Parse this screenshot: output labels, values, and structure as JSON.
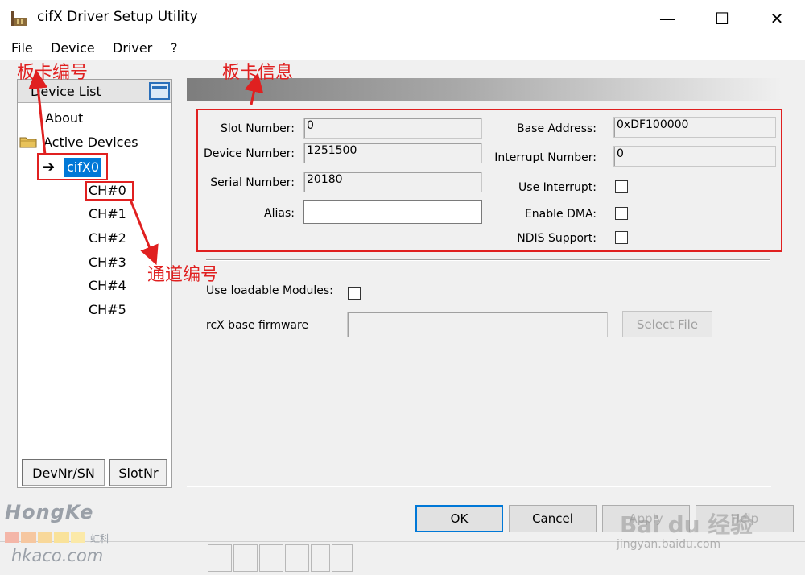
{
  "window": {
    "title": "cifX Driver Setup Utility",
    "minimize_glyph": "—",
    "maximize_glyph": "☐",
    "close_glyph": "✕"
  },
  "menu": {
    "items": [
      "File",
      "Device",
      "Driver",
      "?"
    ]
  },
  "device_list": {
    "title": "Device List",
    "about": "About",
    "active_devices": "Active Devices",
    "device": "cifX0",
    "channels": [
      "CH#0",
      "CH#1",
      "CH#2",
      "CH#3",
      "CH#4",
      "CH#5"
    ],
    "tabs": [
      "DevNr/SN",
      "SlotNr"
    ]
  },
  "device_info": {
    "slot_number_label": "Slot Number:",
    "slot_number": "0",
    "device_number_label": "Device Number:",
    "device_number": "1251500",
    "serial_number_label": "Serial Number:",
    "serial_number": "20180",
    "alias_label": "Alias:",
    "alias": "",
    "base_address_label": "Base Address:",
    "base_address": "0xDF100000",
    "interrupt_number_label": "Interrupt Number:",
    "interrupt_number": "0",
    "use_interrupt_label": "Use Interrupt:",
    "use_interrupt": false,
    "enable_dma_label": "Enable DMA:",
    "enable_dma": false,
    "ndis_support_label": "NDIS Support:",
    "ndis_support": false
  },
  "modules": {
    "use_loadable_label": "Use loadable Modules:",
    "use_loadable": false,
    "base_firmware_label": "rcX base firmware",
    "base_firmware": "",
    "select_file_label": "Select File"
  },
  "buttons": {
    "ok": "OK",
    "cancel": "Cancel",
    "apply": "Apply",
    "help": "Help"
  },
  "annotations": {
    "board_number": "板卡编号",
    "board_info": "板卡信息",
    "channel_number": "通道编号",
    "color": "#e02020"
  },
  "watermarks": {
    "hongke": "HongKe",
    "hongke_cn": "虹科",
    "hongke_site": "hkaco.com",
    "baidu": "Bai du 经验",
    "baidu_site": "jingyan.baidu.com"
  }
}
